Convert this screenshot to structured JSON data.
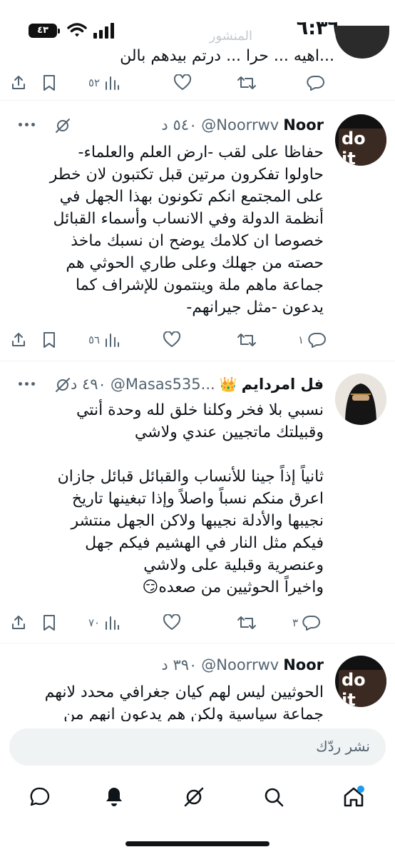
{
  "status_bar": {
    "time": "٦:٣٦",
    "battery": "٤٣"
  },
  "top_partial": {
    "ghost_text": "المنشور",
    "prev_text": "...اهيه ... حرا ... درتم بيدهم بالن",
    "stats": {
      "views": "٥٢"
    }
  },
  "tweets": [
    {
      "name": "Noor",
      "handle": "@Noorrwv",
      "time": "٥٤٠ د",
      "avatar_text": "do it",
      "text": "حفاظا على لقب -ارض العلم والعلماء-\nحاولوا تفكرون مرتين قبل تكتبون لان خطر\nعلى المجتمع انكم تكونون بهذا الجهل في\nأنظمة الدولة وفي الانساب وأسماء القبائل\nخصوصا ان كلامك يوضح ان نسبك ماخذ\nحصته من جهلك وعلى طاري الحوثي هم\nجماعة ماهم ملة وينتمون للإشراف كما\nيدعون -مثل جيرانهم-",
      "stats": {
        "replies": "١",
        "retweets": "",
        "likes": "",
        "views": "٥٦"
      }
    },
    {
      "name": "فل امردايم",
      "crown": "👑",
      "handle": "@Masas535...",
      "time": "٤٩٠ د",
      "text": "نسبي بلا فخر وكلنا خلق لله وحدة أنتي\nوقبيلتك ماتجيين عندي ولاشي\n\nثانياً إذاً جينا للأنساب والقبائل قبائل جازان\nاعرق منكم نسباً واصلاً وإذا تبغينها تاريخ\nنجيبها والأدلة نجيبها ولاكن الجهل منتشر\nفيكم مثل النار في الهشيم فيكم جهل\nوعنصرية وقبلية على ولاشي\nواخيراً الحوثيين من صعده😏",
      "stats": {
        "replies": "٣",
        "retweets": "",
        "likes": "",
        "views": "٧٠"
      }
    },
    {
      "name": "Noor",
      "handle": "@Noorrwv",
      "time": "٣٩٠ د",
      "avatar_text": "do it",
      "text": "الحوثيين ليس لهم كيان جغرافي محدد لانهم\nجماعة سياسية ولكن هم يدعون انهم من"
    }
  ],
  "reply_bar": {
    "placeholder": "نشر ردّك"
  },
  "tab_bar": {
    "items": [
      "home-icon",
      "search-icon",
      "grok-icon",
      "notifications-icon",
      "messages-icon"
    ]
  }
}
